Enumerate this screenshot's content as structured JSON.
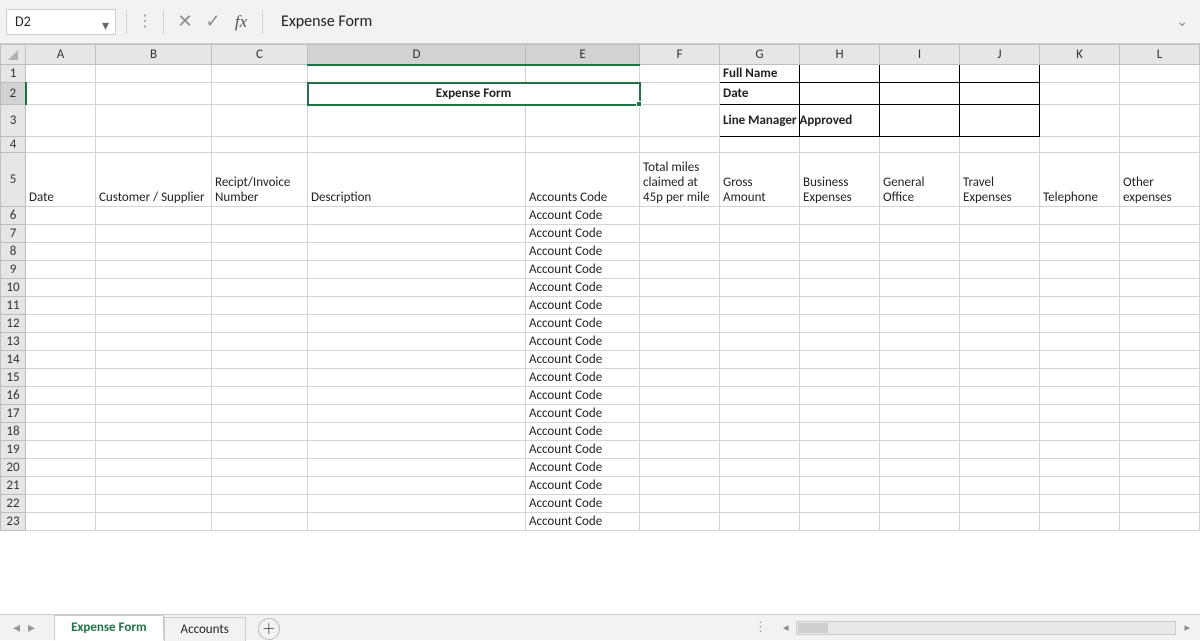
{
  "formula_bar": {
    "cell_ref": "D2",
    "formula": "Expense Form",
    "cancel_glyph": "✕",
    "confirm_glyph": "✓",
    "fx_label": "fx",
    "expand_glyph": "⌄",
    "dropdown_glyph": "▾"
  },
  "columns": [
    "A",
    "B",
    "C",
    "D",
    "E",
    "F",
    "G",
    "H",
    "I",
    "J",
    "K",
    "L"
  ],
  "row_numbers": [
    1,
    2,
    3,
    4,
    5,
    6,
    7,
    8,
    9,
    10,
    11,
    12,
    13,
    14,
    15,
    16,
    17,
    18,
    19,
    20,
    21,
    22,
    23
  ],
  "title_cell": "Expense Form",
  "info_labels": {
    "full_name": "Full Name",
    "date": "Date",
    "line_manager": "Line Manager Approved"
  },
  "grid_headers": {
    "A": "Date",
    "B": "Customer / Supplier",
    "C": "Recipt/Invoice Number",
    "D": "Description",
    "E": "Accounts Code",
    "F": "Total miles claimed at 45p per mile",
    "G": "Gross Amount",
    "H": "Business Expenses",
    "I": "General Office",
    "J": "Travel Expenses",
    "K": "Telephone",
    "L": "Other expenses"
  },
  "account_code_text": "Account Code",
  "sheet_tabs": {
    "active": "Expense Form",
    "other": "Accounts"
  },
  "nav": {
    "first": "◂",
    "prev": "◂",
    "plus": "＋",
    "dots": "⋮",
    "hs_left": "◂",
    "hs_right": "▸"
  }
}
